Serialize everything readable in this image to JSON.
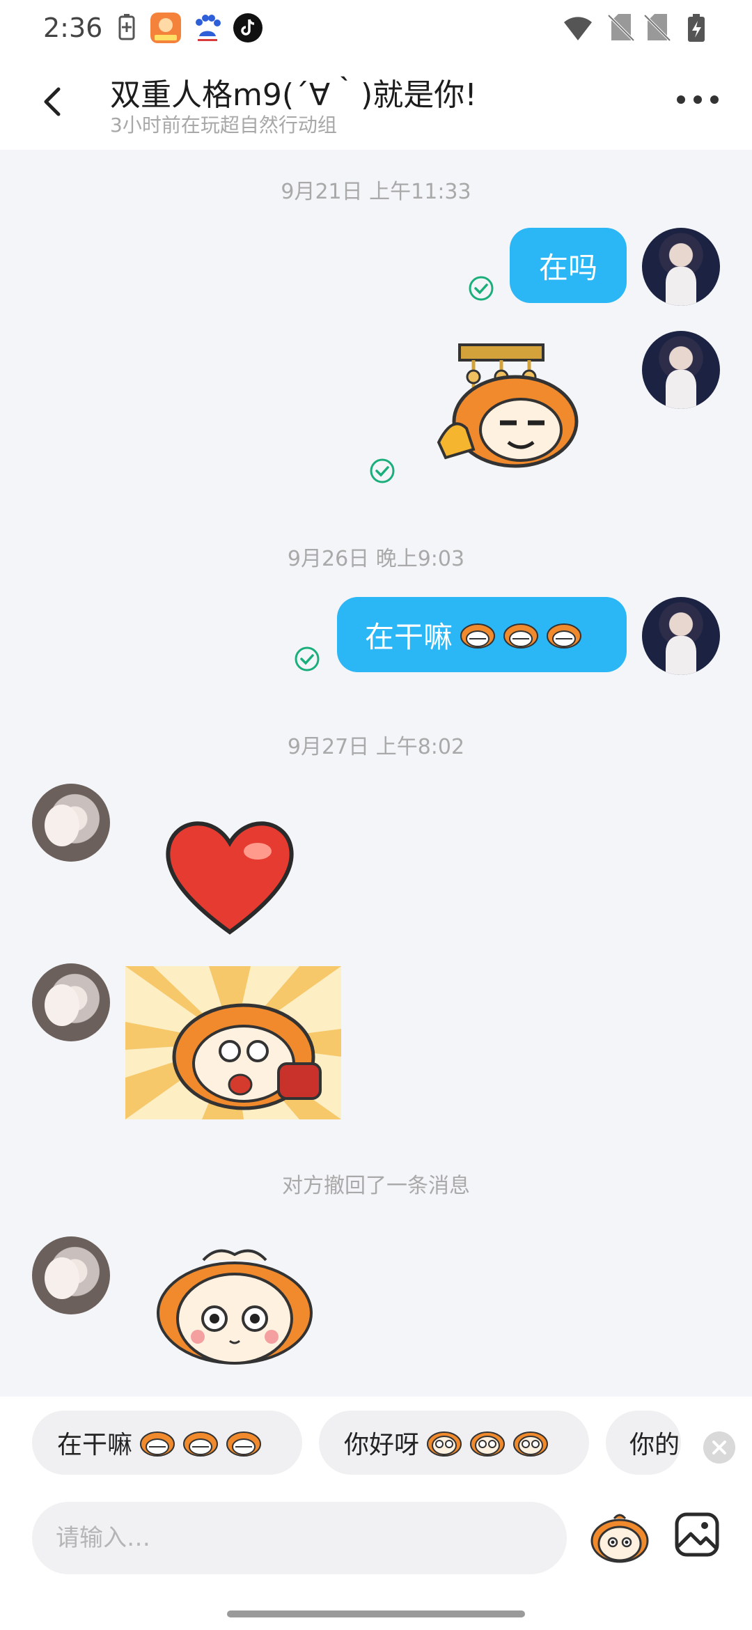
{
  "status_bar": {
    "time": "2:36",
    "left_icons": [
      "battery-saver-icon",
      "game-app-icon",
      "baidu-app-icon",
      "tiktok-app-icon"
    ],
    "right_icons": [
      "wifi-icon",
      "no-sim-icon",
      "no-sim-icon",
      "battery-charging-icon"
    ]
  },
  "header": {
    "title": "双重人格m9(´∀｀)就是你!",
    "subtitle": "3小时前在玩超自然行动组",
    "back_icon": "chevron-left-icon",
    "more_icon": "more-horizontal-icon"
  },
  "messages": {
    "ts1": "9月21日 上午11:33",
    "m1_text": "在吗",
    "ts2": "9月26日 晚上9:03",
    "m3_text": "在干嘛",
    "ts3": "9月27日 上午8:02",
    "recalled": "对方撤回了一条消息"
  },
  "quick_replies": [
    {
      "label": "在干嘛"
    },
    {
      "label": "你好呀"
    },
    {
      "label": "你的"
    }
  ],
  "input": {
    "placeholder": "请输入…"
  },
  "colors": {
    "bubble": "#2bb6f5",
    "check": "#1aae7b",
    "chat_bg": "#f3f5f8",
    "mascot_orange": "#f08a2c"
  }
}
